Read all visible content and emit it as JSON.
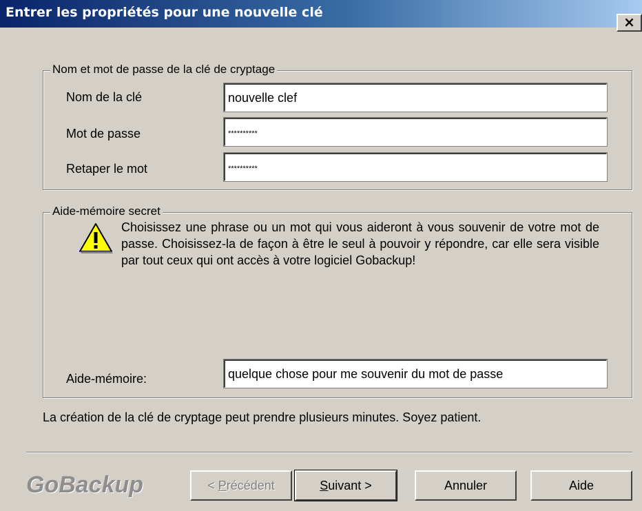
{
  "window": {
    "title": "Entrer les propriétés pour une nouvelle clé",
    "close_label": "×"
  },
  "key_group": {
    "legend": "Nom et mot de passe de la clé de cryptage",
    "name_label": "Nom de la clé",
    "name_value": "nouvelle clef",
    "password_label": "Mot de passe",
    "password_value": "**********",
    "retype_label": "Retaper le mot",
    "retype_value": "**********"
  },
  "hint_group": {
    "legend": "Aide-mémoire secret",
    "warning_icon": "warning-icon",
    "message": "Choisissez une phrase ou un mot qui vous aideront à vous souvenir de votre mot de passe. Choisissez-la de façon à être le seul à pouvoir y répondre, car elle sera visible par tout ceux qui ont accès à votre logiciel Gobackup!",
    "hint_label": "Aide-mémoire:",
    "hint_value": "quelque chose pour me souvenir du mot de passe"
  },
  "note": "La création de la clé de cryptage peut prendre plusieurs minutes. Soyez patient.",
  "brand": "GoBackup",
  "buttons": {
    "previous_mnemonic": "P",
    "previous_rest": "récédent",
    "previous_prefix": "< ",
    "next_mnemonic": "S",
    "next_rest": "uivant >",
    "cancel": "Annuler",
    "help": "Aide"
  }
}
